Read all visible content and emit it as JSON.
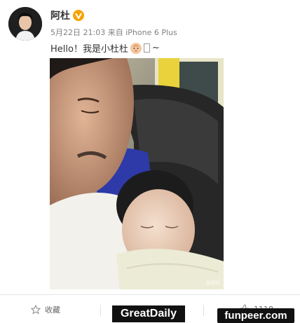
{
  "post": {
    "username": "阿杜",
    "timestamp": "5月22日 21:03",
    "source_prefix": "来自",
    "source": "iPhone 6 Plus",
    "text": "Hello！我是小杜杜",
    "text_suffix": "~",
    "image_watermark": "@阿杜"
  },
  "actions": {
    "favorite_label": "收藏",
    "like_count": "1118"
  },
  "watermarks": {
    "left": "GreatDaily",
    "right": "funpeer.com"
  },
  "colors": {
    "verified_badge": "#f6a300",
    "meta_text": "#808080",
    "divider": "#e6e6e6"
  }
}
